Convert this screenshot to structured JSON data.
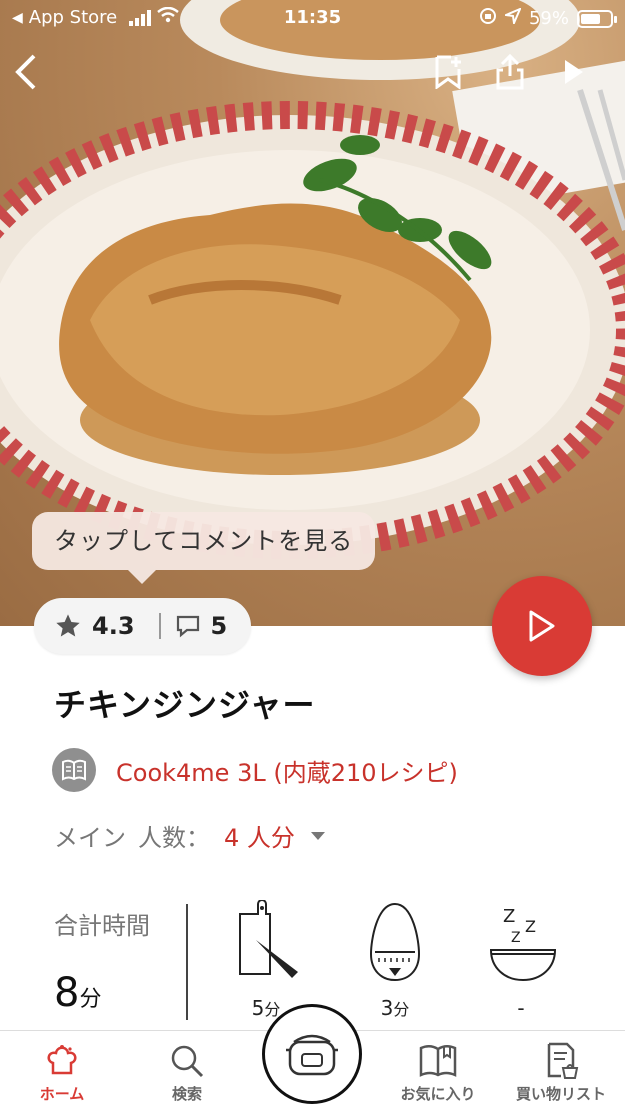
{
  "status_bar": {
    "back_app": "App Store",
    "time": "11:35",
    "battery_text": "59%",
    "battery_level": 0.59
  },
  "header": {
    "back_icon": "chevron-left-icon",
    "bookmark_icon": "bookmark-add-icon",
    "share_icon": "share-icon",
    "play_icon": "play-icon"
  },
  "tooltip": {
    "text": "タップしてコメントを見る"
  },
  "rating": {
    "score": "4.3",
    "comments": "5"
  },
  "recipe": {
    "title": "チキンジンジャー",
    "device": "Cook4me 3L (内蔵210レシピ)",
    "category": "メイン",
    "servings_label": "人数：",
    "servings_value": "4 人分"
  },
  "timing": {
    "total_label": "合計時間",
    "total_value": "8",
    "total_unit": "分",
    "prep_num": "5",
    "prep_unit": "分",
    "cook_num": "3",
    "cook_unit": "分",
    "rest": "-"
  },
  "tabs": [
    {
      "label": "ホーム",
      "icon": "chef-hat-icon"
    },
    {
      "label": "検索",
      "icon": "search-icon"
    },
    {
      "label": "",
      "icon": "pressure-cooker-icon"
    },
    {
      "label": "お気に入り",
      "icon": "book-icon"
    },
    {
      "label": "買い物リスト",
      "icon": "shopping-list-icon"
    }
  ],
  "colors": {
    "accent": "#d93b35",
    "link": "#c8322b"
  }
}
